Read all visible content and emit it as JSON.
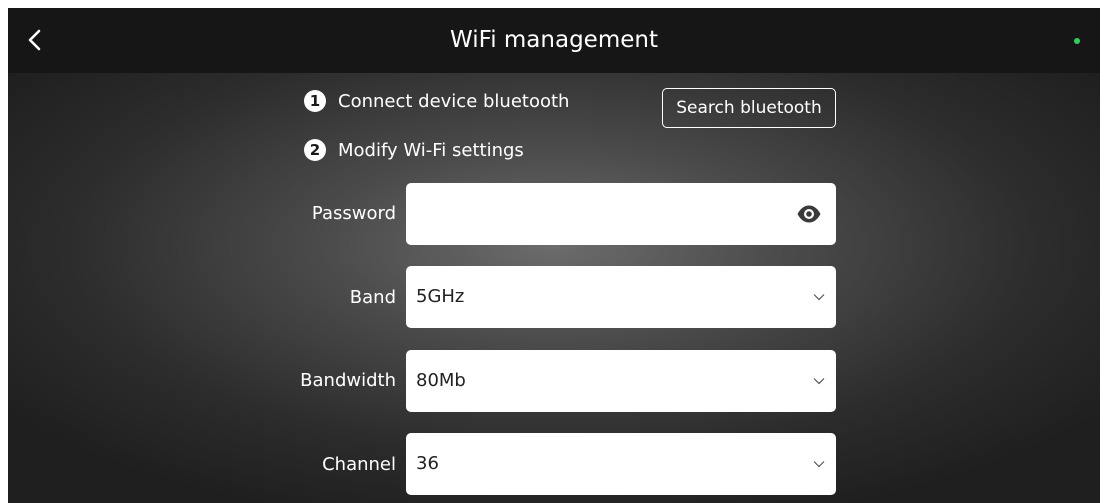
{
  "header": {
    "title": "WiFi management",
    "back_icon": "chevron-left-icon",
    "status_color": "#2ed158"
  },
  "steps": [
    {
      "number": "1",
      "label": "Connect device bluetooth"
    },
    {
      "number": "2",
      "label": "Modify Wi-Fi settings"
    }
  ],
  "search_button": {
    "label": "Search bluetooth"
  },
  "form": {
    "password": {
      "label": "Password",
      "value": "",
      "toggle_icon": "eye-icon"
    },
    "band": {
      "label": "Band",
      "value": "5GHz"
    },
    "bandwidth": {
      "label": "Bandwidth",
      "value": "80Mb"
    },
    "channel": {
      "label": "Channel",
      "value": "36"
    }
  }
}
